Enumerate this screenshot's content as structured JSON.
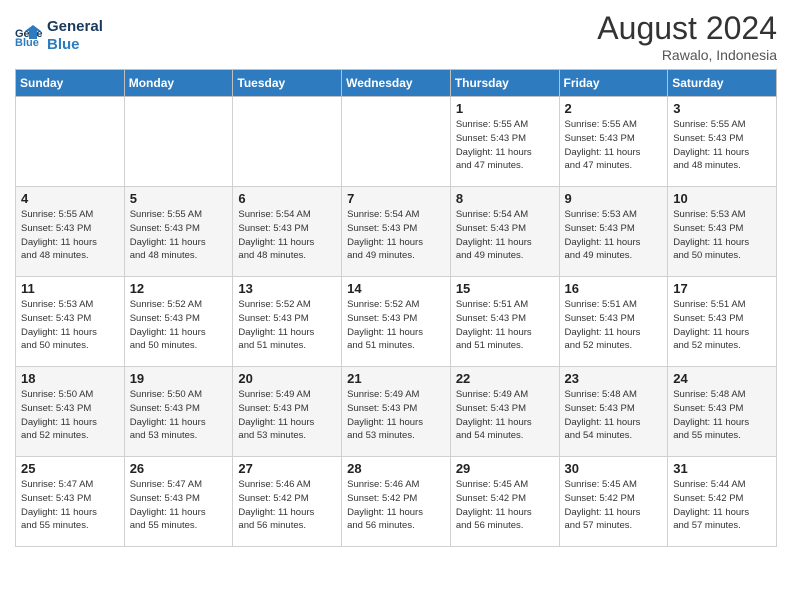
{
  "header": {
    "logo_line1": "General",
    "logo_line2": "Blue",
    "month_year": "August 2024",
    "location": "Rawalo, Indonesia"
  },
  "weekdays": [
    "Sunday",
    "Monday",
    "Tuesday",
    "Wednesday",
    "Thursday",
    "Friday",
    "Saturday"
  ],
  "weeks": [
    [
      {
        "day": "",
        "info": ""
      },
      {
        "day": "",
        "info": ""
      },
      {
        "day": "",
        "info": ""
      },
      {
        "day": "",
        "info": ""
      },
      {
        "day": "1",
        "info": "Sunrise: 5:55 AM\nSunset: 5:43 PM\nDaylight: 11 hours\nand 47 minutes."
      },
      {
        "day": "2",
        "info": "Sunrise: 5:55 AM\nSunset: 5:43 PM\nDaylight: 11 hours\nand 47 minutes."
      },
      {
        "day": "3",
        "info": "Sunrise: 5:55 AM\nSunset: 5:43 PM\nDaylight: 11 hours\nand 48 minutes."
      }
    ],
    [
      {
        "day": "4",
        "info": "Sunrise: 5:55 AM\nSunset: 5:43 PM\nDaylight: 11 hours\nand 48 minutes."
      },
      {
        "day": "5",
        "info": "Sunrise: 5:55 AM\nSunset: 5:43 PM\nDaylight: 11 hours\nand 48 minutes."
      },
      {
        "day": "6",
        "info": "Sunrise: 5:54 AM\nSunset: 5:43 PM\nDaylight: 11 hours\nand 48 minutes."
      },
      {
        "day": "7",
        "info": "Sunrise: 5:54 AM\nSunset: 5:43 PM\nDaylight: 11 hours\nand 49 minutes."
      },
      {
        "day": "8",
        "info": "Sunrise: 5:54 AM\nSunset: 5:43 PM\nDaylight: 11 hours\nand 49 minutes."
      },
      {
        "day": "9",
        "info": "Sunrise: 5:53 AM\nSunset: 5:43 PM\nDaylight: 11 hours\nand 49 minutes."
      },
      {
        "day": "10",
        "info": "Sunrise: 5:53 AM\nSunset: 5:43 PM\nDaylight: 11 hours\nand 50 minutes."
      }
    ],
    [
      {
        "day": "11",
        "info": "Sunrise: 5:53 AM\nSunset: 5:43 PM\nDaylight: 11 hours\nand 50 minutes."
      },
      {
        "day": "12",
        "info": "Sunrise: 5:52 AM\nSunset: 5:43 PM\nDaylight: 11 hours\nand 50 minutes."
      },
      {
        "day": "13",
        "info": "Sunrise: 5:52 AM\nSunset: 5:43 PM\nDaylight: 11 hours\nand 51 minutes."
      },
      {
        "day": "14",
        "info": "Sunrise: 5:52 AM\nSunset: 5:43 PM\nDaylight: 11 hours\nand 51 minutes."
      },
      {
        "day": "15",
        "info": "Sunrise: 5:51 AM\nSunset: 5:43 PM\nDaylight: 11 hours\nand 51 minutes."
      },
      {
        "day": "16",
        "info": "Sunrise: 5:51 AM\nSunset: 5:43 PM\nDaylight: 11 hours\nand 52 minutes."
      },
      {
        "day": "17",
        "info": "Sunrise: 5:51 AM\nSunset: 5:43 PM\nDaylight: 11 hours\nand 52 minutes."
      }
    ],
    [
      {
        "day": "18",
        "info": "Sunrise: 5:50 AM\nSunset: 5:43 PM\nDaylight: 11 hours\nand 52 minutes."
      },
      {
        "day": "19",
        "info": "Sunrise: 5:50 AM\nSunset: 5:43 PM\nDaylight: 11 hours\nand 53 minutes."
      },
      {
        "day": "20",
        "info": "Sunrise: 5:49 AM\nSunset: 5:43 PM\nDaylight: 11 hours\nand 53 minutes."
      },
      {
        "day": "21",
        "info": "Sunrise: 5:49 AM\nSunset: 5:43 PM\nDaylight: 11 hours\nand 53 minutes."
      },
      {
        "day": "22",
        "info": "Sunrise: 5:49 AM\nSunset: 5:43 PM\nDaylight: 11 hours\nand 54 minutes."
      },
      {
        "day": "23",
        "info": "Sunrise: 5:48 AM\nSunset: 5:43 PM\nDaylight: 11 hours\nand 54 minutes."
      },
      {
        "day": "24",
        "info": "Sunrise: 5:48 AM\nSunset: 5:43 PM\nDaylight: 11 hours\nand 55 minutes."
      }
    ],
    [
      {
        "day": "25",
        "info": "Sunrise: 5:47 AM\nSunset: 5:43 PM\nDaylight: 11 hours\nand 55 minutes."
      },
      {
        "day": "26",
        "info": "Sunrise: 5:47 AM\nSunset: 5:43 PM\nDaylight: 11 hours\nand 55 minutes."
      },
      {
        "day": "27",
        "info": "Sunrise: 5:46 AM\nSunset: 5:42 PM\nDaylight: 11 hours\nand 56 minutes."
      },
      {
        "day": "28",
        "info": "Sunrise: 5:46 AM\nSunset: 5:42 PM\nDaylight: 11 hours\nand 56 minutes."
      },
      {
        "day": "29",
        "info": "Sunrise: 5:45 AM\nSunset: 5:42 PM\nDaylight: 11 hours\nand 56 minutes."
      },
      {
        "day": "30",
        "info": "Sunrise: 5:45 AM\nSunset: 5:42 PM\nDaylight: 11 hours\nand 57 minutes."
      },
      {
        "day": "31",
        "info": "Sunrise: 5:44 AM\nSunset: 5:42 PM\nDaylight: 11 hours\nand 57 minutes."
      }
    ]
  ]
}
